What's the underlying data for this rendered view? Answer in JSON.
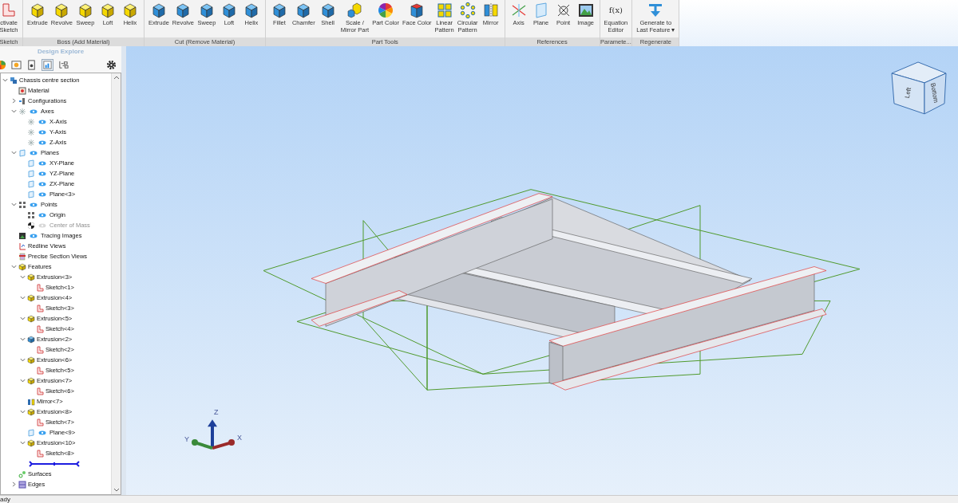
{
  "ribbon": {
    "groups": [
      {
        "label": "Sketch",
        "buttons": [
          {
            "label": "ctivate\nSketch",
            "kind": "sketch"
          }
        ]
      },
      {
        "label": "Boss (Add Material)",
        "buttons": [
          {
            "label": "Extrude",
            "kind": "boss"
          },
          {
            "label": "Revolve",
            "kind": "boss"
          },
          {
            "label": "Sweep",
            "kind": "boss"
          },
          {
            "label": "Loft",
            "kind": "boss"
          },
          {
            "label": "Helix",
            "kind": "boss"
          }
        ]
      },
      {
        "label": "Cut (Remove Material)",
        "buttons": [
          {
            "label": "Extrude",
            "kind": "cut"
          },
          {
            "label": "Revolve",
            "kind": "cut"
          },
          {
            "label": "Sweep",
            "kind": "cut"
          },
          {
            "label": "Loft",
            "kind": "cut"
          },
          {
            "label": "Helix",
            "kind": "cut"
          }
        ]
      },
      {
        "label": "Part Tools",
        "buttons": [
          {
            "label": "Fillet",
            "kind": "cut"
          },
          {
            "label": "Chamfer",
            "kind": "cut"
          },
          {
            "label": "Shell",
            "kind": "cut"
          },
          {
            "label": "Scale /\nMirror Part",
            "kind": "scale"
          },
          {
            "label": "Part Color",
            "kind": "wheel"
          },
          {
            "label": "Face Color",
            "kind": "face"
          },
          {
            "label": "Linear\nPattern",
            "kind": "linear"
          },
          {
            "label": "Circular\nPattern",
            "kind": "circular"
          },
          {
            "label": "Mirror",
            "kind": "mirror"
          }
        ]
      },
      {
        "label": "References",
        "buttons": [
          {
            "label": "Axis",
            "kind": "axis"
          },
          {
            "label": "Plane",
            "kind": "plane"
          },
          {
            "label": "Point",
            "kind": "point"
          },
          {
            "label": "Image",
            "kind": "image"
          }
        ]
      },
      {
        "label": "Paramete...",
        "buttons": [
          {
            "label": "Equation\nEditor",
            "glyph": "f(x)"
          }
        ]
      },
      {
        "label": "Regenerate",
        "buttons": [
          {
            "label": "Generate to\nLast Feature ▾",
            "kind": "regen"
          }
        ]
      }
    ]
  },
  "explorer": {
    "title": "Design Explore",
    "tree": [
      {
        "label": "Chassis centre section",
        "kind": "part",
        "expanded": true,
        "children": [
          {
            "label": "Material",
            "kind": "material"
          },
          {
            "label": "Configurations",
            "kind": "config",
            "expanded": false
          },
          {
            "label": "Axes",
            "kind": "axis",
            "visible": true,
            "expanded": true,
            "children": [
              {
                "label": "X-Axis",
                "kind": "axis",
                "visible": true
              },
              {
                "label": "Y-Axis",
                "kind": "axis",
                "visible": true
              },
              {
                "label": "Z-Axis",
                "kind": "axis",
                "visible": true
              }
            ]
          },
          {
            "label": "Planes",
            "kind": "plane",
            "visible": true,
            "expanded": true,
            "children": [
              {
                "label": "XY-Plane",
                "kind": "plane",
                "visible": true
              },
              {
                "label": "YZ-Plane",
                "kind": "plane",
                "visible": true
              },
              {
                "label": "ZX-Plane",
                "kind": "plane",
                "visible": true
              },
              {
                "label": "Plane<3>",
                "kind": "plane",
                "visible": true
              }
            ]
          },
          {
            "label": "Points",
            "kind": "point",
            "visible": true,
            "expanded": true,
            "children": [
              {
                "label": "Origin",
                "kind": "point",
                "visible": true
              },
              {
                "label": "Center of Mass",
                "kind": "mass",
                "visible": false,
                "disabled": true
              }
            ]
          },
          {
            "label": "Tracing Images",
            "kind": "image",
            "visible": true
          },
          {
            "label": "Redline Views",
            "kind": "redline"
          },
          {
            "label": "Precise Section Views",
            "kind": "section"
          },
          {
            "label": "Features",
            "kind": "boss",
            "expanded": true,
            "children": [
              {
                "label": "Extrusion<3>",
                "kind": "boss",
                "expanded": true,
                "children": [
                  {
                    "label": "Sketch<1>",
                    "kind": "sketch"
                  }
                ]
              },
              {
                "label": "Extrusion<4>",
                "kind": "boss",
                "expanded": true,
                "children": [
                  {
                    "label": "Sketch<3>",
                    "kind": "sketch"
                  }
                ]
              },
              {
                "label": "Extrusion<5>",
                "kind": "boss",
                "expanded": true,
                "children": [
                  {
                    "label": "Sketch<4>",
                    "kind": "sketch"
                  }
                ]
              },
              {
                "label": "Extrusion<2>",
                "kind": "cut",
                "expanded": true,
                "children": [
                  {
                    "label": "Sketch<2>",
                    "kind": "sketch"
                  }
                ]
              },
              {
                "label": "Extrusion<6>",
                "kind": "boss",
                "expanded": true,
                "children": [
                  {
                    "label": "Sketch<5>",
                    "kind": "sketch"
                  }
                ]
              },
              {
                "label": "Extrusion<7>",
                "kind": "boss",
                "expanded": true,
                "children": [
                  {
                    "label": "Sketch<6>",
                    "kind": "sketch"
                  }
                ]
              },
              {
                "label": "Mirror<7>",
                "kind": "mirror"
              },
              {
                "label": "Extrusion<8>",
                "kind": "boss",
                "expanded": true,
                "children": [
                  {
                    "label": "Sketch<7>",
                    "kind": "sketch"
                  }
                ]
              },
              {
                "label": "Plane<9>",
                "kind": "plane",
                "visible": true
              },
              {
                "label": "Extrusion<10>",
                "kind": "boss",
                "expanded": true,
                "children": [
                  {
                    "label": "Sketch<8>",
                    "kind": "sketch"
                  }
                ]
              },
              {
                "kind": "rollback"
              }
            ]
          },
          {
            "label": "Surfaces",
            "kind": "surface"
          },
          {
            "label": "Edges",
            "kind": "edge",
            "expanded": false
          }
        ]
      }
    ]
  },
  "viewport": {
    "view_cube": {
      "faces": [
        "Left",
        "Bottom"
      ]
    },
    "triad": {
      "axes": [
        "Z",
        "Y",
        "X"
      ]
    }
  },
  "status_bar": {
    "text": "ady"
  }
}
